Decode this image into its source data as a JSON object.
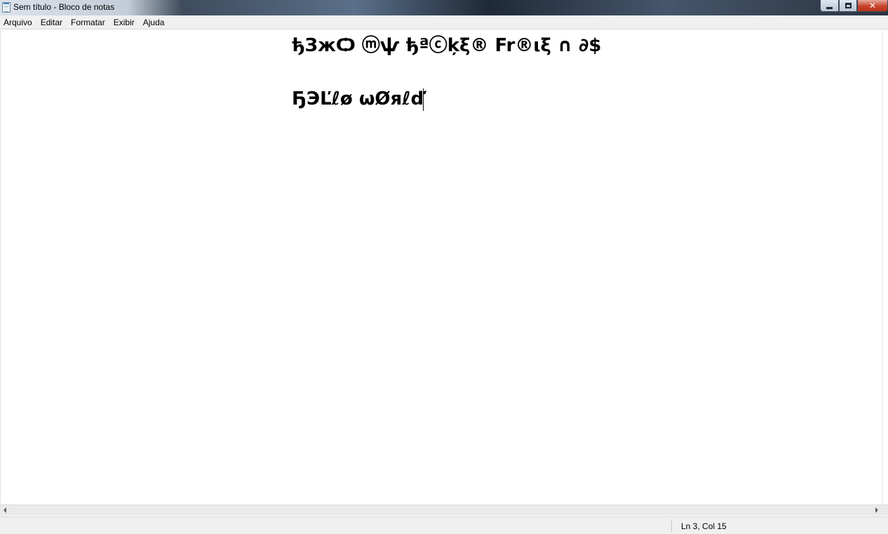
{
  "window": {
    "title": "Sem título - Bloco de notas",
    "icon": "notepad-icon",
    "controls": {
      "minimize_icon": "minimize-icon",
      "maximize_icon": "restore-icon",
      "close_icon": "close-icon",
      "close_glyph": "✕"
    }
  },
  "menubar": {
    "items": [
      {
        "label": "Arquivo"
      },
      {
        "label": "Editar"
      },
      {
        "label": "Formatar"
      },
      {
        "label": "Exibir"
      },
      {
        "label": "Ajuda"
      }
    ]
  },
  "editor": {
    "lines": [
      "ђЗжѺ ⓜѱ ђªⓒķξ® Fr®ιξ ∩ ∂$",
      "ҔЭĽℓø ωØяℓď"
    ]
  },
  "statusbar": {
    "position": "Ln 3, Col 15"
  }
}
